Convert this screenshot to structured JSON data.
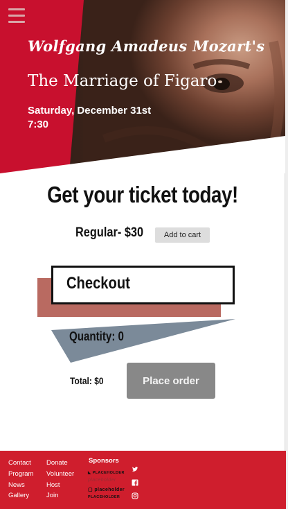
{
  "hero": {
    "composer": "Wolfgang Amadeus Mozart's",
    "title": "The Marriage of Figaro",
    "date_line1": "Saturday, December 31st",
    "date_line2": "7:30",
    "menu_icon": "hamburger-menu-icon",
    "accent_color": "#c8102e"
  },
  "main": {
    "headline": "Get your ticket today!",
    "ticket_label": "Regular- $30",
    "add_to_cart_label": "Add to cart",
    "checkout_title": "Checkout",
    "quantity_label": "Quantity: 0",
    "total_label": "Total: $0",
    "place_order_label": "Place order"
  },
  "footer": {
    "links_col1": [
      "Contact",
      "Program",
      "News",
      "Gallery"
    ],
    "links_col2": [
      "Donate",
      "Volunteer",
      "Host",
      "Join"
    ],
    "sponsors_title": "Sponsors",
    "sponsor_logos": [
      "PLACEHOLDER",
      "placeholder",
      "placeholder",
      "PLACEHOLDER"
    ],
    "social_icons": [
      "twitter-icon",
      "facebook-icon",
      "instagram-icon"
    ],
    "background_color": "#cf1e2d"
  }
}
